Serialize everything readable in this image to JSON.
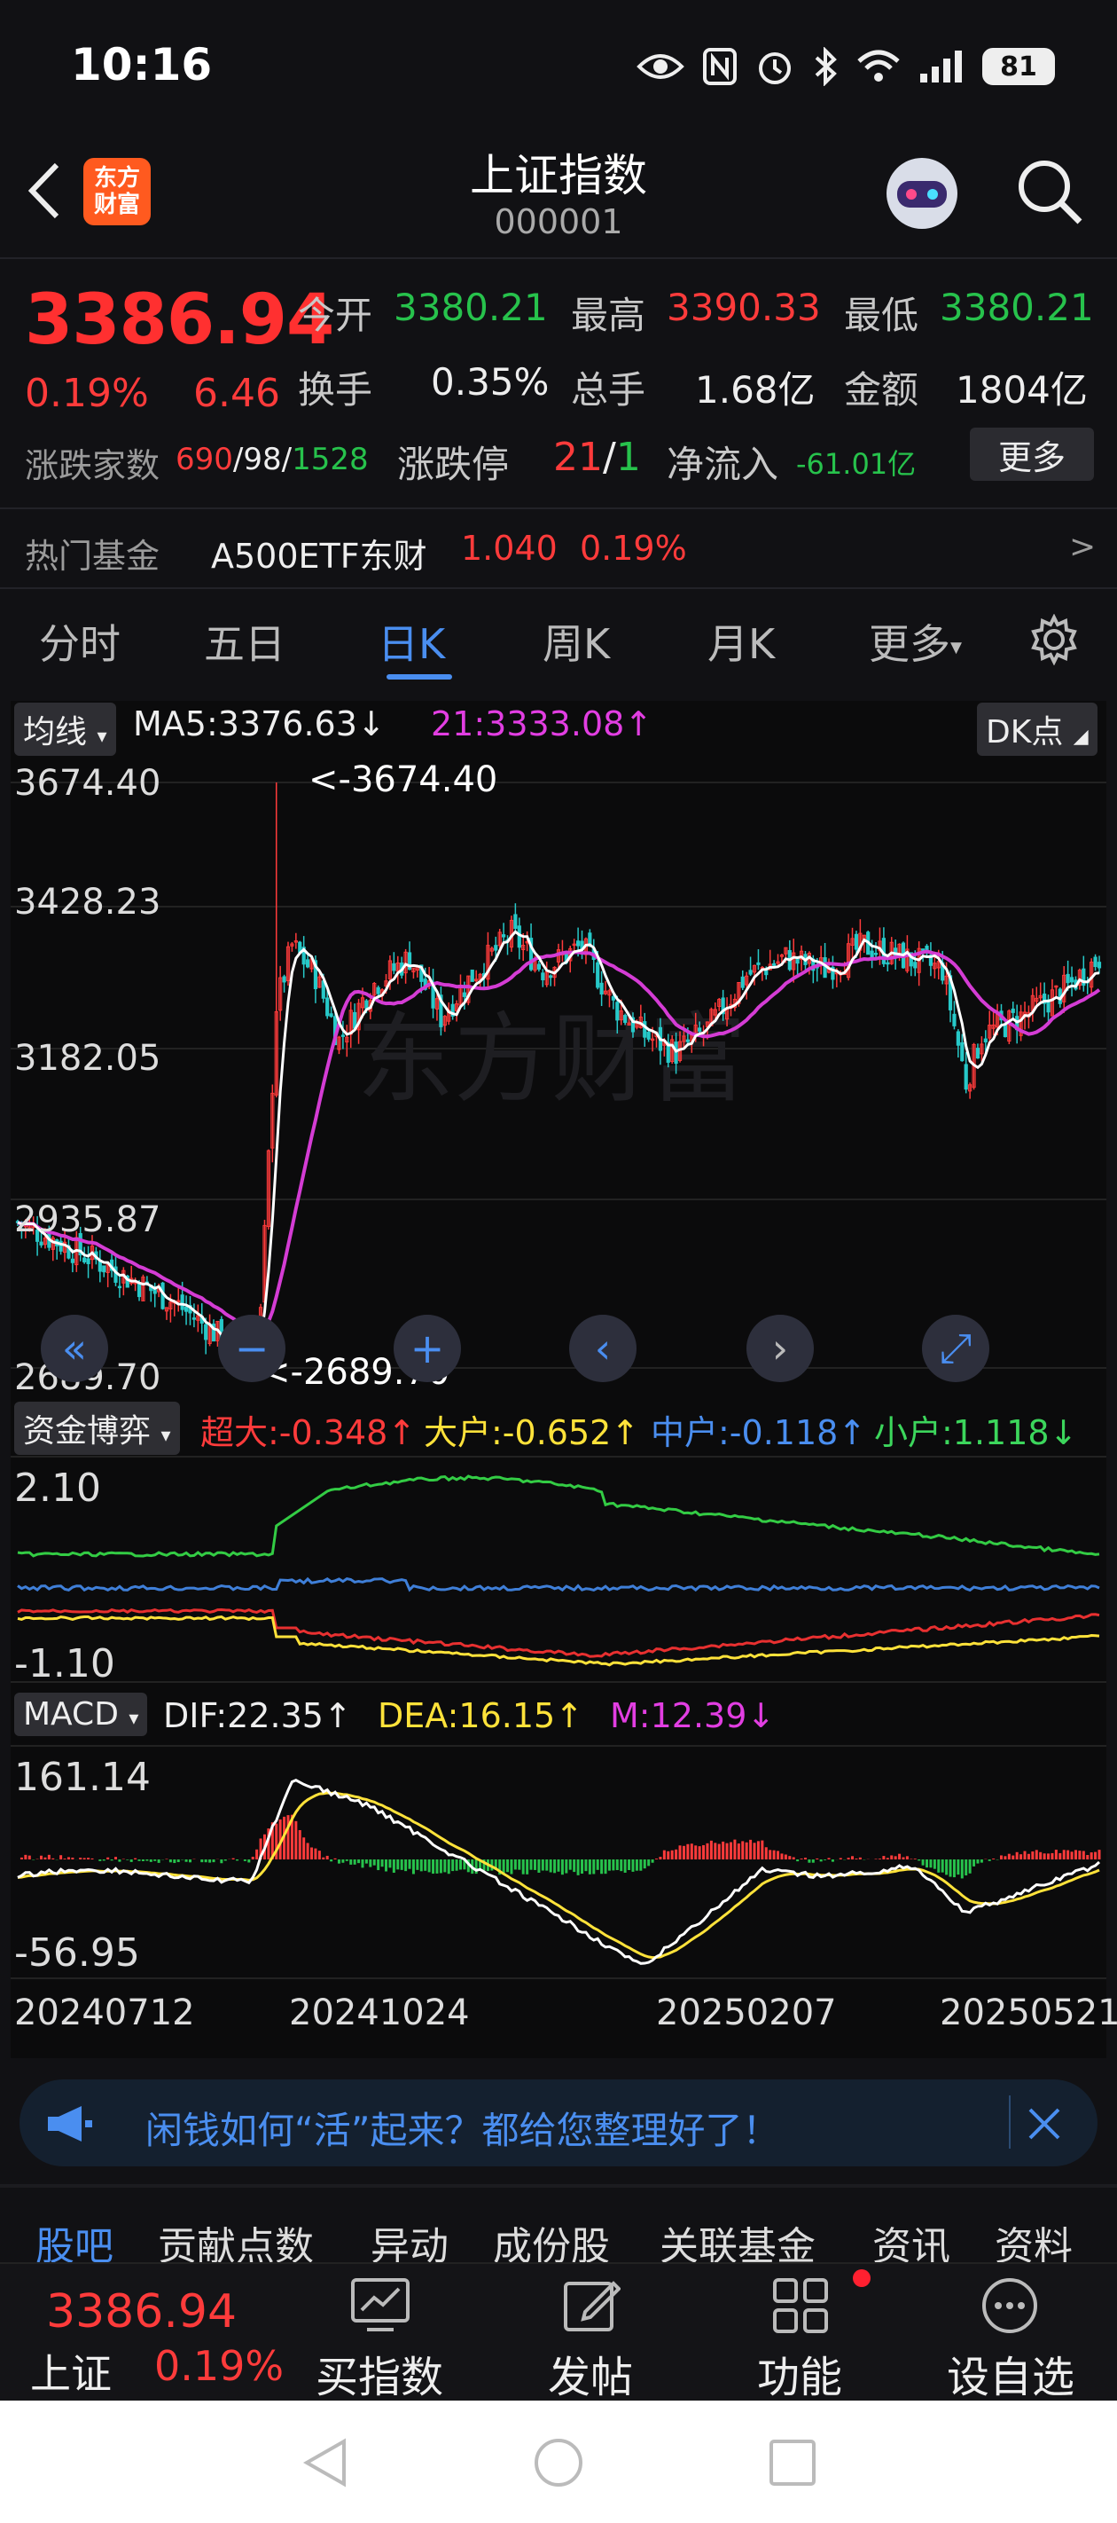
{
  "status_bar": {
    "time": "10:16",
    "battery": "81"
  },
  "header": {
    "title": "上证指数",
    "code": "000001",
    "logo_line1": "东方",
    "logo_line2": "财富"
  },
  "quote": {
    "price": "3386.94",
    "change_pct": "0.19%",
    "change": "6.46",
    "open_label": "今开",
    "open": "3380.21",
    "high_label": "最高",
    "high": "3390.33",
    "low_label": "最低",
    "low": "3380.21",
    "turnover_label": "换手",
    "turnover": "0.35%",
    "volume_label": "总手",
    "volume": "1.68亿",
    "amount_label": "金额",
    "amount": "1804亿",
    "updown_label": "涨跌家数",
    "up_count": "690",
    "flat_count": "98",
    "down_count": "1528",
    "limit_label": "涨跌停",
    "limit_up": "21",
    "limit_down": "1",
    "netflow_label": "净流入",
    "netflow": "-61.01亿",
    "more_button": "更多"
  },
  "hot_fund": {
    "label": "热门基金",
    "name": "A500ETF东财",
    "price": "1.040",
    "pct": "0.19%"
  },
  "period_tabs": [
    "分时",
    "五日",
    "日K",
    "周K",
    "月K",
    "更多"
  ],
  "active_period": "日K",
  "kline": {
    "selector": "均线",
    "ma5": "MA5:3376.63↓",
    "ma21": "21:3333.08↑",
    "dk_button": "DK点",
    "y_labels": [
      "3674.40",
      "3428.23",
      "3182.05",
      "2935.87",
      "2689.70"
    ],
    "max_marker": "<-3674.40",
    "min_marker": "<-2689.70",
    "watermark": "东方财富"
  },
  "fund_flow": {
    "selector": "资金博弈",
    "super": "超大:-0.348↑",
    "large": "大户:-0.652↑",
    "mid": "中户:-0.118↑",
    "small": "小户:1.118↓",
    "y_top": "2.10",
    "y_bottom": "-1.10"
  },
  "macd": {
    "selector": "MACD",
    "dif": "DIF:22.35↑",
    "dea": "DEA:16.15↑",
    "m": "M:12.39↓",
    "y_top": "161.14",
    "y_bottom": "-56.95"
  },
  "x_labels": [
    "20240712",
    "20241024",
    "20250207",
    "20250521"
  ],
  "banner": {
    "text": "闲钱如何“活”起来？都给您整理好了！"
  },
  "bottom_tabs": [
    "股吧",
    "贡献点数",
    "异动",
    "成份股",
    "关联基金",
    "资讯",
    "资料"
  ],
  "bottom_nav": {
    "price": "3386.94",
    "name": "上证",
    "pct": "0.19%",
    "buy": "买指数",
    "post": "发帖",
    "func": "功能",
    "watch": "设自选"
  },
  "colors": {
    "up": "#ff3b3b",
    "down": "#27c24c",
    "accent": "#4a8ef0",
    "ma21": "#e23ee2"
  }
}
